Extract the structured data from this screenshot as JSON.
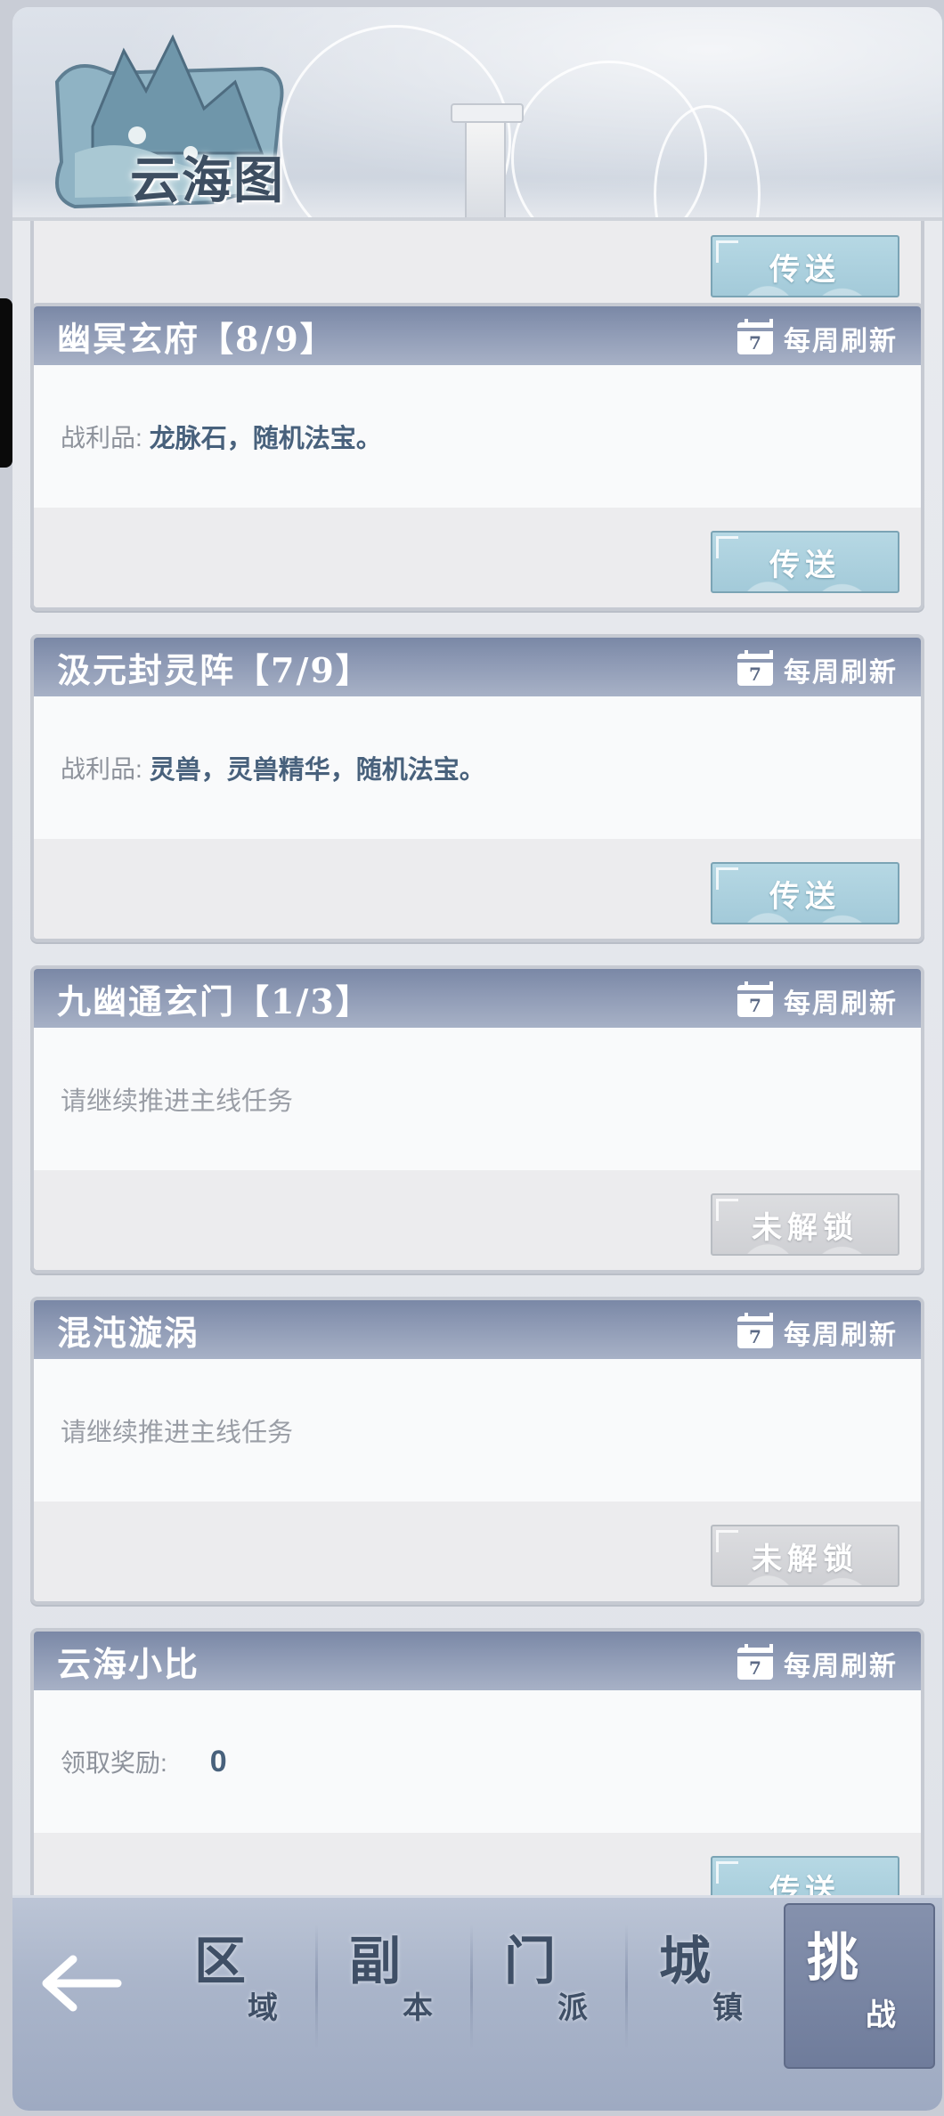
{
  "header": {
    "title": "云海图"
  },
  "partial_top": {
    "button_label": "传送"
  },
  "cards": [
    {
      "title": "幽冥玄府【8/9】",
      "refresh_label": "每周刷新",
      "calendar_day": "7",
      "body_label": "战利品:",
      "body_text": "龙脉石，随机法宝。",
      "button_label": "传送",
      "button_state": "active"
    },
    {
      "title": "汲元封灵阵【7/9】",
      "refresh_label": "每周刷新",
      "calendar_day": "7",
      "body_label": "战利品:",
      "body_text": "灵兽，灵兽精华，随机法宝。",
      "button_label": "传送",
      "button_state": "active"
    },
    {
      "title": "九幽通玄门【1/3】",
      "refresh_label": "每周刷新",
      "calendar_day": "7",
      "body_text": "请继续推进主线任务",
      "button_label": "未解锁",
      "button_state": "locked"
    },
    {
      "title": "混沌漩涡",
      "refresh_label": "每周刷新",
      "calendar_day": "7",
      "body_text": "请继续推进主线任务",
      "button_label": "未解锁",
      "button_state": "locked"
    },
    {
      "title": "云海小比",
      "refresh_label": "每周刷新",
      "calendar_day": "7",
      "body_label": "领取奖励:",
      "body_value": "0",
      "button_label": "传送",
      "button_state": "active"
    }
  ],
  "nav": {
    "tabs": [
      {
        "main": "区",
        "sub": "域"
      },
      {
        "main": "副",
        "sub": "本"
      },
      {
        "main": "门",
        "sub": "派"
      },
      {
        "main": "城",
        "sub": "镇"
      },
      {
        "main": "挑",
        "sub": "战",
        "active": true
      }
    ]
  },
  "colors": {
    "card_header": "#8d99b4",
    "teleport_button": "#a3cad9",
    "locked_button": "#cfd0d4",
    "nav_background": "#aab5ca"
  }
}
